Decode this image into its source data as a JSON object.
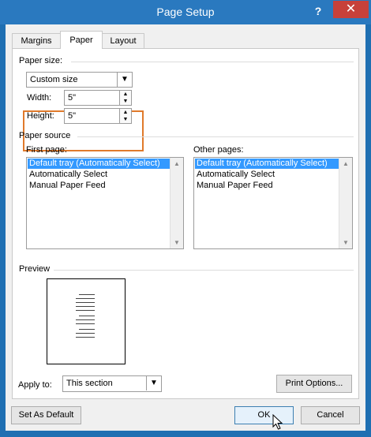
{
  "window": {
    "title": "Page Setup",
    "help_label": "?",
    "close_label": "✕"
  },
  "tabs": [
    {
      "label": "Margins"
    },
    {
      "label": "Paper"
    },
    {
      "label": "Layout"
    }
  ],
  "paper_size": {
    "group_label": "Paper size:",
    "selected": "Custom size",
    "width_label": "Width:",
    "width_value": "5\"",
    "height_label": "Height:",
    "height_value": "5\""
  },
  "paper_source": {
    "group_label": "Paper source",
    "first_page_label": "First page:",
    "other_pages_label": "Other pages:",
    "first_page_items": [
      "Default tray (Automatically Select)",
      "Automatically Select",
      "Manual Paper Feed"
    ],
    "other_pages_items": [
      "Default tray (Automatically Select)",
      "Automatically Select",
      "Manual Paper Feed"
    ],
    "selected_index": 0
  },
  "preview": {
    "group_label": "Preview"
  },
  "apply_to": {
    "label": "Apply to:",
    "selected": "This section"
  },
  "buttons": {
    "print_options": "Print Options...",
    "set_as_default": "Set As Default",
    "ok": "OK",
    "cancel": "Cancel"
  },
  "colors": {
    "title_bar": "#2a79bf",
    "close_button": "#c7413a",
    "highlight_outline": "#e07a2b",
    "selection": "#3399ff"
  }
}
